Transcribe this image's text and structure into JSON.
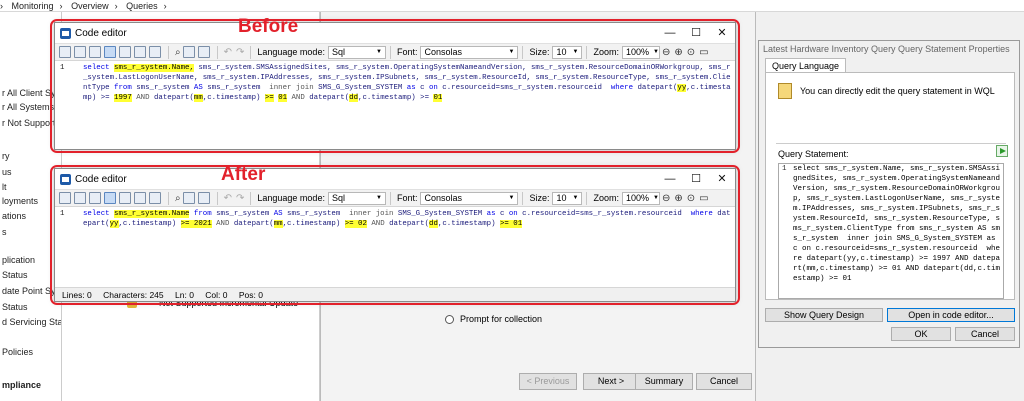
{
  "breadcrumb": [
    "Monitoring",
    "Overview",
    "Queries"
  ],
  "nav": {
    "items": [
      "r All Client Sy",
      "r All Systems o",
      "r Not Support",
      "ry",
      "us",
      "lt",
      "loyments",
      "ations",
      "s",
      "",
      "plication",
      "Status",
      "date Point Sy",
      "Status",
      "d Servicing Status",
      "Policies",
      "mpliance"
    ]
  },
  "list": {
    "row_label": "Not Supported Incremental Update"
  },
  "wizard": {
    "radio_label": "Prompt for collection",
    "buttons": {
      "previous": "< Previous",
      "next": "Next >",
      "summary": "Summary",
      "cancel": "Cancel"
    }
  },
  "props": {
    "title": "Latest Hardware Inventory Query Query Statement Properties",
    "tab": "Query Language",
    "info": "You can directly edit the query statement in WQL",
    "statement_label": "Query Statement:",
    "line_number": "1",
    "statement": "select sms_r_system.Name, sms_r_system.SMSAssignedSites, sms_r_system.OperatingSystemNameandVersion, sms_r_system.ResourceDomainORWorkgroup, sms_r_system.LastLogonUserName, sms_r_system.IPAddresses, sms_r_system.IPSubnets, sms_r_system.ResourceId, sms_r_system.ResourceType, sms_r_system.ClientType from sms_r_system AS sms_r_system  inner join SMS_G_System_SYSTEM as c on c.resourceid=sms_r_system.resourceid  where datepart(yy,c.timestamp) >= 1997 AND datepart(mm,c.timestamp) >= 01 AND datepart(dd,c.timestamp) >= 01",
    "buttons": {
      "show_design": "Show Query Design",
      "open_editor": "Open in code editor...",
      "ok": "OK",
      "cancel": "Cancel"
    }
  },
  "annotations": {
    "before": "Before",
    "after": "After"
  },
  "editor": {
    "title": "Code editor",
    "language_label": "Language mode:",
    "language_value": "Sql",
    "font_label": "Font:",
    "font_value": "Consolas",
    "size_label": "Size:",
    "size_value": "10",
    "zoom_label": "Zoom:",
    "zoom_value": "100%",
    "line_number": "1",
    "window_buttons": {
      "minimize": "—",
      "maximize": "☐",
      "close": "✕"
    }
  },
  "editor_before": {
    "tokens": [
      [
        "kw",
        "select "
      ],
      [
        "hl",
        "sms_r_system.Name,"
      ],
      [
        "fld",
        " sms_r_system.SMSAssignedSites, sms_r_system.OperatingSystemNameandVersion, sms_r_system.ResourceDomainORWorkgroup, sms_r_system.LastLogonUserName, sms_r_system.IPAddresses, sms_r_system.IPSubnets, sms_r_system.ResourceId, sms_r_system.ResourceType, sms_r_system.ClientType "
      ],
      [
        "kw",
        "from"
      ],
      [
        "fld",
        " sms_r_system "
      ],
      [
        "kw",
        "AS"
      ],
      [
        "fld",
        " sms_r_system  "
      ],
      [
        "op",
        "inner join"
      ],
      [
        "fld",
        " SMS_G_System_SYSTEM "
      ],
      [
        "kw",
        "as"
      ],
      [
        "fld",
        " c "
      ],
      [
        "kw",
        "on"
      ],
      [
        "fld",
        " c.resourceid=sms_r_system.resourceid  "
      ],
      [
        "kw",
        "where"
      ],
      [
        "fld",
        " datepart("
      ],
      [
        "hl",
        "yy"
      ],
      [
        "fld",
        ",c.timestamp) >= "
      ],
      [
        "hl",
        "1997"
      ],
      [
        "op",
        " AND "
      ],
      [
        "fld",
        "datepart("
      ],
      [
        "hl",
        "mm"
      ],
      [
        "fld",
        ",c.timestamp) "
      ],
      [
        "hl",
        ">="
      ],
      [
        "fld",
        " "
      ],
      [
        "hl",
        "01"
      ],
      [
        "op",
        " AND "
      ],
      [
        "fld",
        "datepart("
      ],
      [
        "hl",
        "dd"
      ],
      [
        "fld",
        ",c.timestamp) >= "
      ],
      [
        "hl",
        "01"
      ]
    ]
  },
  "editor_after": {
    "tokens": [
      [
        "kw",
        "select "
      ],
      [
        "hl",
        "sms_r_system.Name"
      ],
      [
        "fld",
        " "
      ],
      [
        "kw",
        "from"
      ],
      [
        "fld",
        " sms_r_system "
      ],
      [
        "kw",
        "AS"
      ],
      [
        "fld",
        " sms_r_system  "
      ],
      [
        "op",
        "inner join"
      ],
      [
        "fld",
        " SMS_G_System_SYSTEM "
      ],
      [
        "kw",
        "as"
      ],
      [
        "fld",
        " c "
      ],
      [
        "kw",
        "on"
      ],
      [
        "fld",
        " c.resourceid=sms_r_system.resourceid  "
      ],
      [
        "kw",
        "where"
      ],
      [
        "fld",
        " datepart("
      ],
      [
        "hl",
        "yy"
      ],
      [
        "fld",
        ",c.timestamp) "
      ],
      [
        "hl",
        ">= 2021"
      ],
      [
        "op",
        " AND "
      ],
      [
        "fld",
        "datepart("
      ],
      [
        "hl",
        "mm"
      ],
      [
        "fld",
        ",c.timestamp) "
      ],
      [
        "hl",
        ">= 02"
      ],
      [
        "op",
        " AND "
      ],
      [
        "fld",
        "datepart("
      ],
      [
        "hl",
        "dd"
      ],
      [
        "fld",
        ",c.timestamp) "
      ],
      [
        "hl",
        ">= 01"
      ]
    ],
    "status": {
      "lines": "Lines:  0",
      "characters": "Characters:  245",
      "ln": "Ln:  0",
      "col": "Col:  0",
      "pos": "Pos:  0"
    }
  }
}
